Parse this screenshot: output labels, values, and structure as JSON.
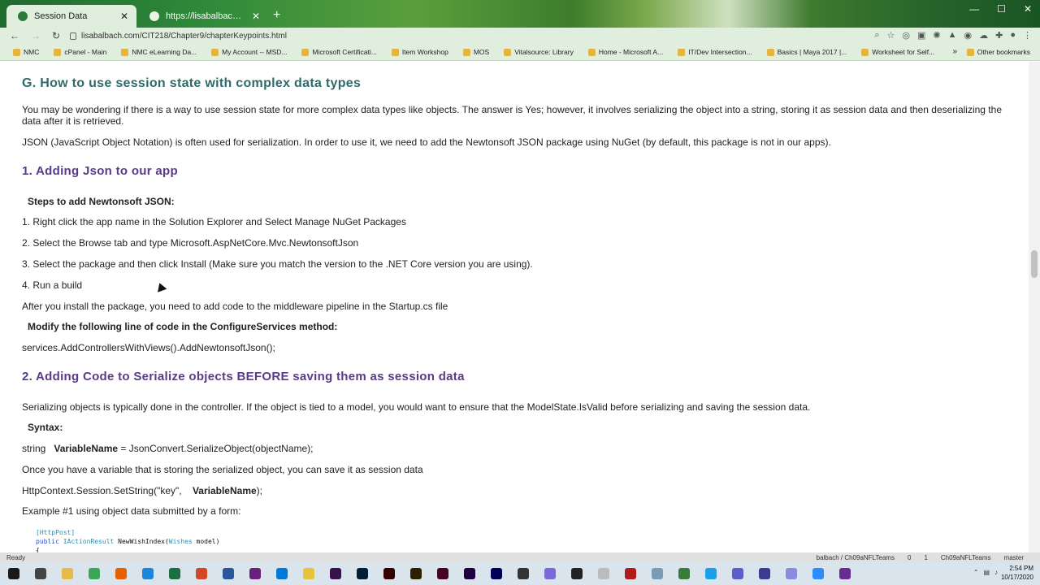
{
  "browser": {
    "tabs": [
      {
        "title": "Session Data",
        "active": true
      },
      {
        "title": "https://lisabalbach.com/CIT218/...",
        "active": false
      }
    ],
    "url": "lisabalbach.com/CIT218/Chapter9/chapterKeypoints.html",
    "bookmarks": [
      "NMC",
      "cPanel - Main",
      "NMC eLearning Da...",
      "My Account -- MSD...",
      "Microsoft Certificati...",
      "Item Workshop",
      "MOS",
      "Vitalsource: Library",
      "Home - Microsoft A...",
      "IT/Dev Intersection...",
      "Basics | Maya 2017 |...",
      "Worksheet for Self..."
    ],
    "other_bookmarks": "Other bookmarks",
    "bookmarks_more": "»"
  },
  "page": {
    "section_title": "G.   How to use session state with complex data types",
    "intro": "You may be wondering if there is a way to use session state for more complex data types like objects.  The answer is Yes; however, it involves serializing the object into a string, storing it as session data and then deserializing the data after it is retrieved.",
    "json_note": "JSON (JavaScript Object Notation) is often used for serialization.  In order to use it, we need to add the Newtonsoft JSON package using NuGet  (by default, this package is not in our apps).",
    "sub1_title": "1.   Adding Json to our app",
    "steps_heading": "Steps to add Newtonsoft JSON:",
    "steps": [
      "1.  Right click the app name in the Solution Explorer and Select Manage NuGet Packages",
      "2.  Select the Browse tab and type Microsoft.AspNetCore.Mvc.NewtonsoftJson",
      "3.  Select the package and then click Install  (Make sure you match the version to the .NET Core version you are using).",
      "4. Run a build"
    ],
    "after_install": "After you install the package, you need to add code to the middleware pipeline in the Startup.cs file",
    "modify_heading": "Modify the following line of code in the ConfigureServices method:",
    "modify_code": "services.AddControllersWithViews().AddNewtonsoftJson();",
    "sub2_title": "2.   Adding Code to Serialize objects BEFORE saving them as session data",
    "serialize_note": "Serializing objects is typically done in the controller.  If the object is tied to a model, you would want to ensure that the ModelState.IsValid before serializing and saving the session data.",
    "syntax_label": "Syntax:",
    "syntax_prefix": "string   ",
    "syntax_var": "VariableName",
    "syntax_suffix": " = JsonConvert.SerializeObject(objectName);",
    "once_note": "Once you have a variable that is storing the serialized object, you can save it as session data",
    "setstring_prefix": "HttpContext.Session.SetString(\"key\",    ",
    "setstring_var": "VariableName",
    "setstring_suffix": ");",
    "example_label": "Example #1 using object data submitted by a form:",
    "code_lines": {
      "attr": "[HttpPost]",
      "kw": "public",
      "type": "IActionResult",
      "method": " NewWishIndex(",
      "param_type": "Wishes",
      "param": " model)",
      "brace": "{"
    }
  },
  "vs_status": {
    "ready": "Ready",
    "repo": "balbach / Ch09aNFLTeams",
    "errors": "0",
    "warnings": "1",
    "project": "Ch09aNFLTeams",
    "branch": "master"
  },
  "clock": {
    "time": "2:54 PM",
    "date": "10/17/2020"
  }
}
